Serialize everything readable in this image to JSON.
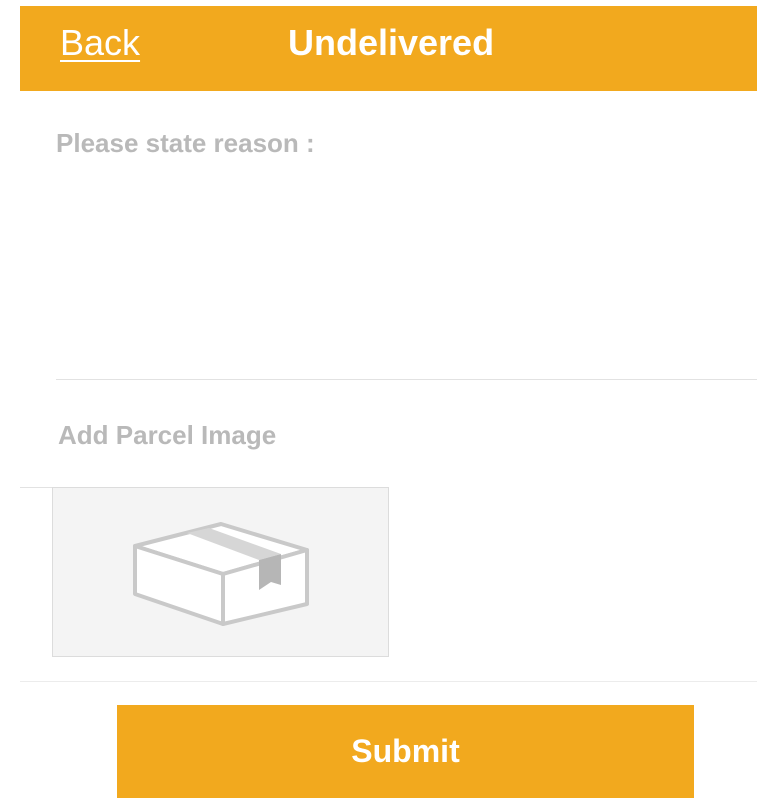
{
  "header": {
    "back_label": "Back",
    "title": "Undelivered",
    "color": "#F2A91E"
  },
  "form": {
    "reason_label": "Please state reason :",
    "reason_value": "",
    "image_label": "Add Parcel Image",
    "image_placeholder_icon": "parcel-box-icon"
  },
  "actions": {
    "submit_label": "Submit",
    "submit_color": "#F2A91E"
  }
}
